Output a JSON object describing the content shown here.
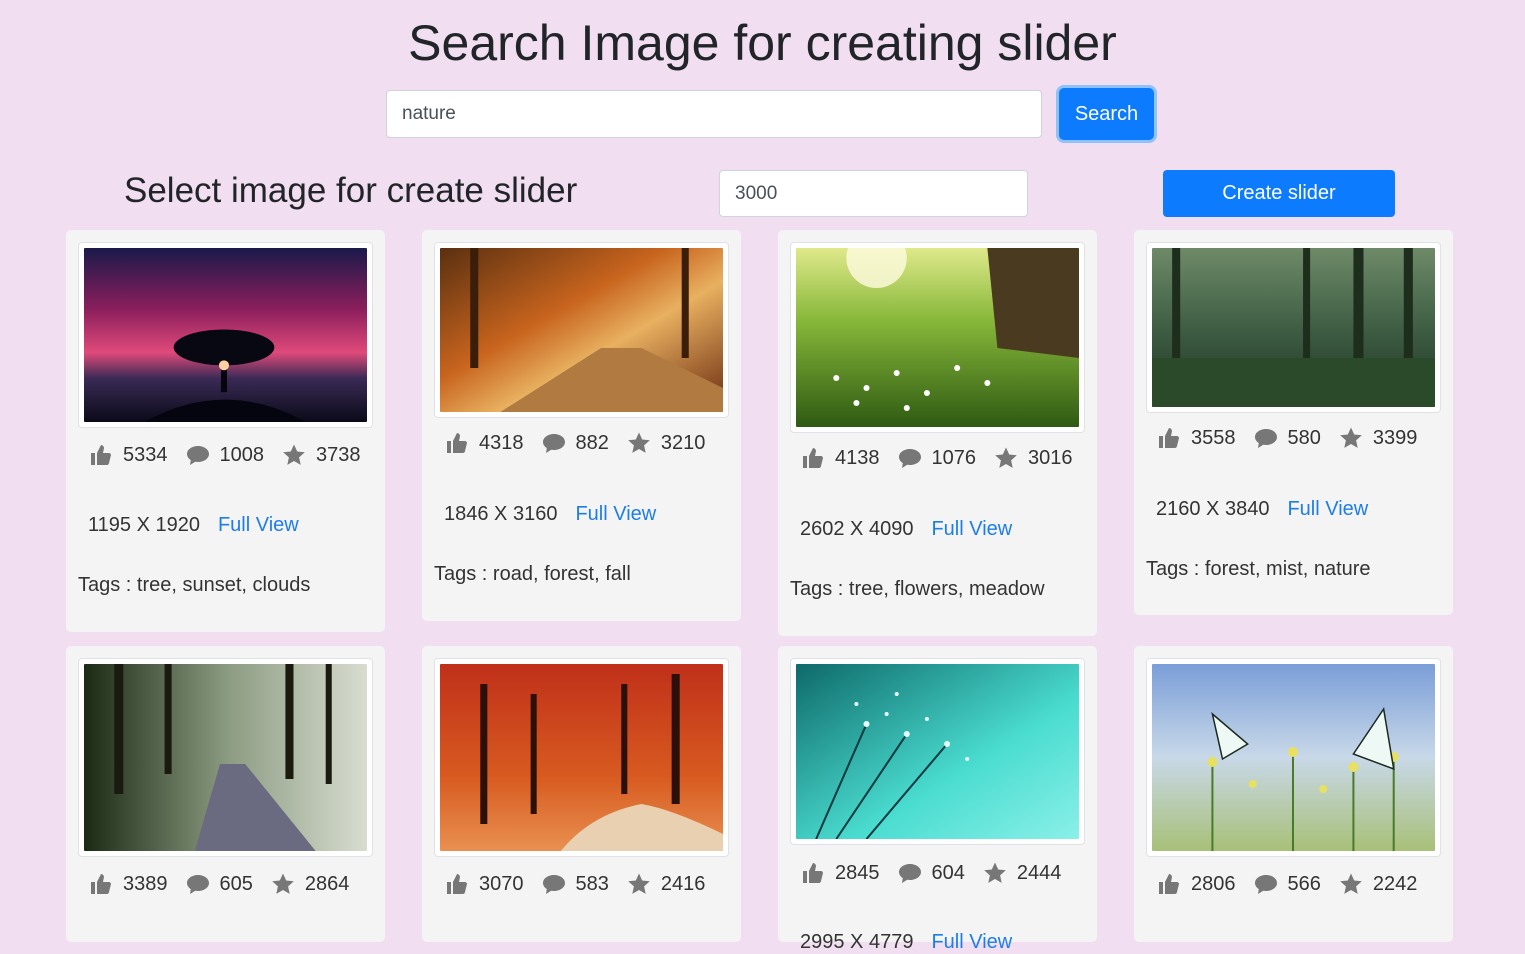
{
  "header": {
    "title": "Search Image for creating slider"
  },
  "search": {
    "value": "nature",
    "button_label": "Search"
  },
  "slider": {
    "heading": "Select image for create slider",
    "duration_value": "3000",
    "create_label": "Create slider"
  },
  "labels": {
    "full_view": "Full View",
    "tags_prefix": "Tags : "
  },
  "icons": [
    "thumbs-up-icon",
    "comment-icon",
    "star-icon"
  ],
  "cards": [
    {
      "likes": "5334",
      "comments": "1008",
      "favorites": "3738",
      "dimensions": "1195 X 1920",
      "tags": "tree, sunset, clouds"
    },
    {
      "likes": "4318",
      "comments": "882",
      "favorites": "3210",
      "dimensions": "1846 X 3160",
      "tags": "road, forest, fall"
    },
    {
      "likes": "4138",
      "comments": "1076",
      "favorites": "3016",
      "dimensions": "2602 X 4090",
      "tags": "tree, flowers, meadow"
    },
    {
      "likes": "3558",
      "comments": "580",
      "favorites": "3399",
      "dimensions": "2160 X 3840",
      "tags": "forest, mist, nature"
    },
    {
      "likes": "3389",
      "comments": "605",
      "favorites": "2864"
    },
    {
      "likes": "3070",
      "comments": "583",
      "favorites": "2416"
    },
    {
      "likes": "2845",
      "comments": "604",
      "favorites": "2444",
      "dimensions": "2995 X 4779"
    },
    {
      "likes": "2806",
      "comments": "566",
      "favorites": "2242"
    }
  ],
  "colors": {
    "background": "#f1def0",
    "card": "#f4f4f4",
    "primary": "#0d7bfe",
    "link": "#1e7ee8",
    "icon": "#777777"
  }
}
